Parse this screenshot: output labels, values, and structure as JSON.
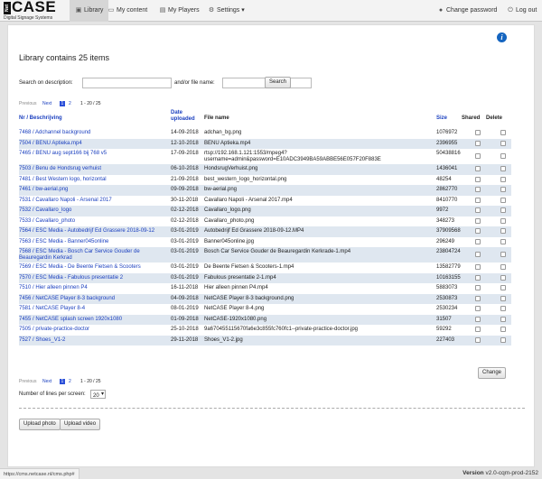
{
  "brand": {
    "net": "Net",
    "case": "CASE",
    "tagline": "Digital Signage Systems"
  },
  "nav": {
    "library": "Library",
    "my_content": "My content",
    "my_players": "My Players",
    "settings": "Settings",
    "change_password": "Change password",
    "logout": "Log out"
  },
  "page": {
    "title": "Library contains 25 items",
    "search_desc_label": "Search on description:",
    "search_desc_value": "",
    "search_file_label": "and/or file name:",
    "search_file_value": "",
    "search_button": "Search"
  },
  "pager": {
    "previous": "Previous",
    "next": "Next",
    "page1": "1",
    "page2": "2",
    "range": "1 - 20 / 25"
  },
  "table": {
    "headers": {
      "name": "Nr / Beschrijving",
      "date": "Date uploaded",
      "file": "File name",
      "size": "Size",
      "shared": "Shared",
      "delete": "Delete"
    },
    "rows": [
      {
        "name": "7468 / Adchannel background",
        "date": "14-09-2018",
        "file": "adchan_bg.png",
        "size": "1076972"
      },
      {
        "name": "7504 / BENU Aptieka.mp4",
        "date": "12-10-2018",
        "file": "BENU Aptieka.mp4",
        "size": "2396955"
      },
      {
        "name": "7465 / BENU aug sept166 bij 768 v5",
        "date": "17-09-2018",
        "file": "rtsp://192.168.1.121:1553/mpeg4?username=admin&password=E10ADC3949BA59ABBE56E057F20F883E",
        "size": "50438816"
      },
      {
        "name": "7503 / Benu de Hondsrug verhuist",
        "date": "06-10-2018",
        "file": "HondsrugVerhuist.png",
        "size": "1436041"
      },
      {
        "name": "7481 / Best Western logo, horizontal",
        "date": "21-09-2018",
        "file": "best_western_logo_horizontal.png",
        "size": "48254"
      },
      {
        "name": "7461 / bw-aerial.png",
        "date": "09-09-2018",
        "file": "bw-aerial.png",
        "size": "2862770"
      },
      {
        "name": "7531 / Cavallaro Napoli - Arsenal 2017",
        "date": "30-11-2018",
        "file": "Cavallaro Napoli - Arsenal 2017.mp4",
        "size": "8410770"
      },
      {
        "name": "7532 / Cavallaro_logo",
        "date": "02-12-2018",
        "file": "Cavallaro_logo.png",
        "size": "9972"
      },
      {
        "name": "7533 / Cavallaro_photo",
        "date": "02-12-2018",
        "file": "Cavallaro_photo.png",
        "size": "348273"
      },
      {
        "name": "7564 / ESC Media - Autobedrijf Ed Grassere 2018-09-12",
        "date": "03-01-2019",
        "file": "Autobedrijf Ed Grassere 2018-09-12.MP4",
        "size": "37909568"
      },
      {
        "name": "7563 / ESC Media - Banner045online",
        "date": "03-01-2019",
        "file": "Banner045online.jpg",
        "size": "296249"
      },
      {
        "name": "7568 / ESC Media - Bosch Car Service Gouder de Beauregardin Kerkrad",
        "date": "03-01-2019",
        "file": "Bosch Car Service Gouder de Beauregardin Kerkrade-1.mp4",
        "size": "23804724"
      },
      {
        "name": "7569 / ESC Media - De Beente Fietsen & Scooters",
        "date": "03-01-2019",
        "file": "De Beente Fietsen & Scooters-1.mp4",
        "size": "13582779"
      },
      {
        "name": "7570 / ESC Media - Fabulous presentatie 2",
        "date": "03-01-2019",
        "file": "Fabulous presentatie 2-1.mp4",
        "size": "10163155"
      },
      {
        "name": "7510 / Hier alleen pinnen P4",
        "date": "16-11-2018",
        "file": "Hier alleen pinnen P4.mp4",
        "size": "5883073"
      },
      {
        "name": "7456 / NetCASE Player 8-3 background",
        "date": "04-09-2018",
        "file": "NetCASE Player 8-3 background.png",
        "size": "2530873"
      },
      {
        "name": "7581 / NetCASE Player 8-4",
        "date": "08-01-2019",
        "file": "NetCASE Player 8-4.png",
        "size": "2530234"
      },
      {
        "name": "7455 / NetCASE splash screen 1920x1080",
        "date": "01-09-2018",
        "file": "NetCASE-1920x1080.png",
        "size": "31507"
      },
      {
        "name": "7505 / private-practice-doctor",
        "date": "25-10-2018",
        "file": "9a670455115670fa6e3c855fc760fc1--private-practice-doctor.jpg",
        "size": "59292"
      },
      {
        "name": "7527 / Shoes_V1-2",
        "date": "29-11-2018",
        "file": "Shoes_V1-2.jpg",
        "size": "227403"
      }
    ]
  },
  "change_button": "Change",
  "lines_label": "Number of lines per screen:",
  "lines_value": "20",
  "upload_photo": "Upload photo",
  "upload_video": "Upload video",
  "status_url": "https://cms.netcase.nl/cms.php#",
  "version_label": "Version",
  "version_value": "v2.0-cqm-prod-2152"
}
